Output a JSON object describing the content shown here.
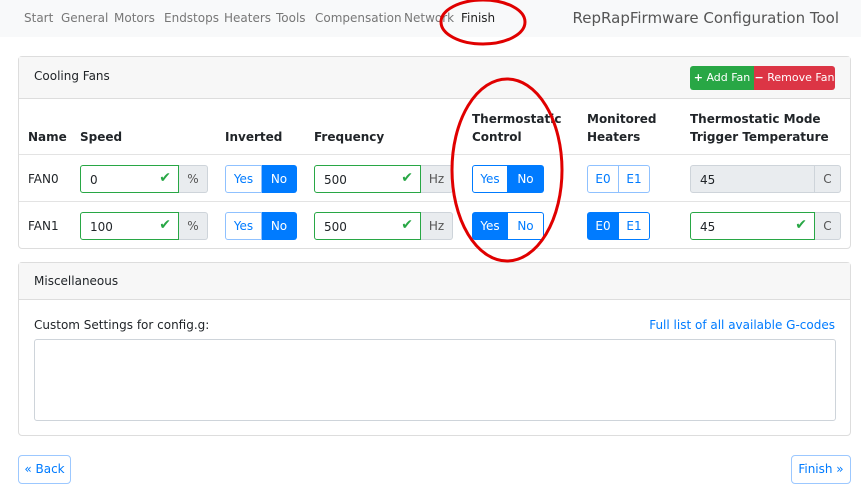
{
  "nav": {
    "items": [
      "Start",
      "General",
      "Motors",
      "Endstops",
      "Heaters",
      "Tools",
      "Compensation",
      "Network",
      "Finish"
    ],
    "active": "Finish",
    "brand": "RepRapFirmware Configuration Tool"
  },
  "fans": {
    "title": "Cooling Fans",
    "add_label": "Add Fan",
    "remove_label": "Remove Fan",
    "headers": {
      "name": "Name",
      "speed": "Speed",
      "inverted": "Inverted",
      "frequency": "Frequency",
      "thermo1": "Thermostatic",
      "thermo2": "Control",
      "mon1": "Monitored",
      "mon2": "Heaters",
      "trig1": "Thermostatic Mode",
      "trig2": "Trigger Temperature"
    },
    "rows": [
      {
        "name": "FAN0",
        "speed": "0",
        "speed_unit": "%",
        "inverted": "No",
        "frequency": "500",
        "freq_unit": "Hz",
        "thermostatic": "No",
        "heaters_selected": [],
        "trigger": "45",
        "trigger_unit": "C",
        "trigger_disabled": true
      },
      {
        "name": "FAN1",
        "speed": "100",
        "speed_unit": "%",
        "inverted": "No",
        "frequency": "500",
        "freq_unit": "Hz",
        "thermostatic": "Yes",
        "heaters_selected": [
          "E0"
        ],
        "trigger": "45",
        "trigger_unit": "C",
        "trigger_disabled": false
      }
    ],
    "yes": "Yes",
    "no": "No",
    "heaters": [
      "E0",
      "E1"
    ]
  },
  "misc": {
    "title": "Miscellaneous",
    "custom_label": "Custom Settings for config.g:",
    "gcodes_link": "Full list of all available G-codes",
    "custom_value": ""
  },
  "footer": {
    "back": "« Back",
    "finish": "Finish »"
  },
  "colors": {
    "primary": "#007bff",
    "success": "#28a745",
    "danger": "#dc3545",
    "annotation": "#e00000"
  }
}
